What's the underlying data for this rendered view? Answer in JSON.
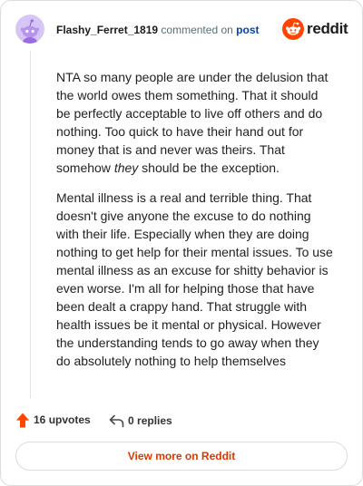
{
  "header": {
    "username": "Flashy_Ferret_1819",
    "action_text": "commented on",
    "post_link_label": "post",
    "brand_wordmark": "reddit"
  },
  "comment": {
    "paragraphs": [
      {
        "lines": [
          "NTA so many people are under the delusion that",
          "the world owes them something. That it should",
          "be perfectly acceptable to live off others and do",
          "nothing. Too quick to have their hand out for",
          "money that is and never was theirs. That"
        ],
        "final_line": {
          "before": "somehow ",
          "emphasis": "they",
          "after": " should be the exception."
        }
      },
      {
        "lines": [
          "Mental illness is a real and terrible thing. That",
          "doesn't give anyone the excuse to do nothing",
          "with their life. Especially when they are doing",
          "nothing to get help for their mental issues. To use",
          "mental illness as an excuse for shitty behavior is",
          "even worse. I'm all for helping those that have",
          "been dealt a crappy hand. That struggle with",
          "health issues be it mental or physical. However",
          "the understanding tends to go away when they",
          "do absolutely nothing to help themselves"
        ]
      }
    ]
  },
  "footer": {
    "upvotes": {
      "count": "16",
      "unit": "upvotes"
    },
    "replies": {
      "count": "0",
      "unit": "replies"
    },
    "view_more_label": "View more on Reddit"
  },
  "icons": {
    "avatar": "snoo-avatar-icon",
    "brand": "reddit-snoo-icon",
    "upvote": "upvote-arrow-icon",
    "reply": "reply-arrow-icon"
  },
  "colors": {
    "brand": "#ff4500",
    "link": "#0045ac",
    "muted-text": "#576f76",
    "body-text": "#222222",
    "call-to-action": "#d93900",
    "card-border": "#dcdcdc"
  }
}
